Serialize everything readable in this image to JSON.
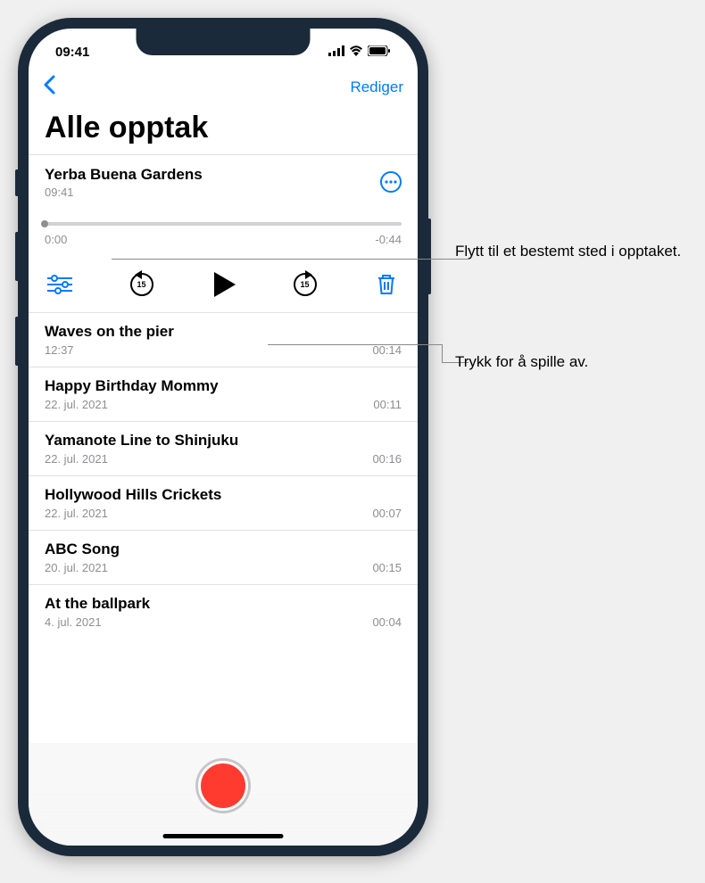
{
  "status_bar": {
    "time": "09:41"
  },
  "nav": {
    "edit_label": "Rediger"
  },
  "page_title": "Alle opptak",
  "selected": {
    "title": "Yerba Buena Gardens",
    "subtitle": "09:41",
    "time_start": "0:00",
    "time_end": "-0:44",
    "skip_amount": "15"
  },
  "recordings": [
    {
      "title": "Waves on the pier",
      "date": "12:37",
      "duration": "00:14"
    },
    {
      "title": "Happy Birthday Mommy",
      "date": "22. jul. 2021",
      "duration": "00:11"
    },
    {
      "title": "Yamanote Line to Shinjuku",
      "date": "22. jul. 2021",
      "duration": "00:16"
    },
    {
      "title": "Hollywood Hills Crickets",
      "date": "22. jul. 2021",
      "duration": "00:07"
    },
    {
      "title": "ABC Song",
      "date": "20. jul. 2021",
      "duration": "00:15"
    },
    {
      "title": "At the ballpark",
      "date": "4. jul. 2021",
      "duration": "00:04"
    }
  ],
  "callouts": {
    "scrubber": "Flytt til et bestemt sted i opptaket.",
    "play": "Trykk for å spille av."
  }
}
